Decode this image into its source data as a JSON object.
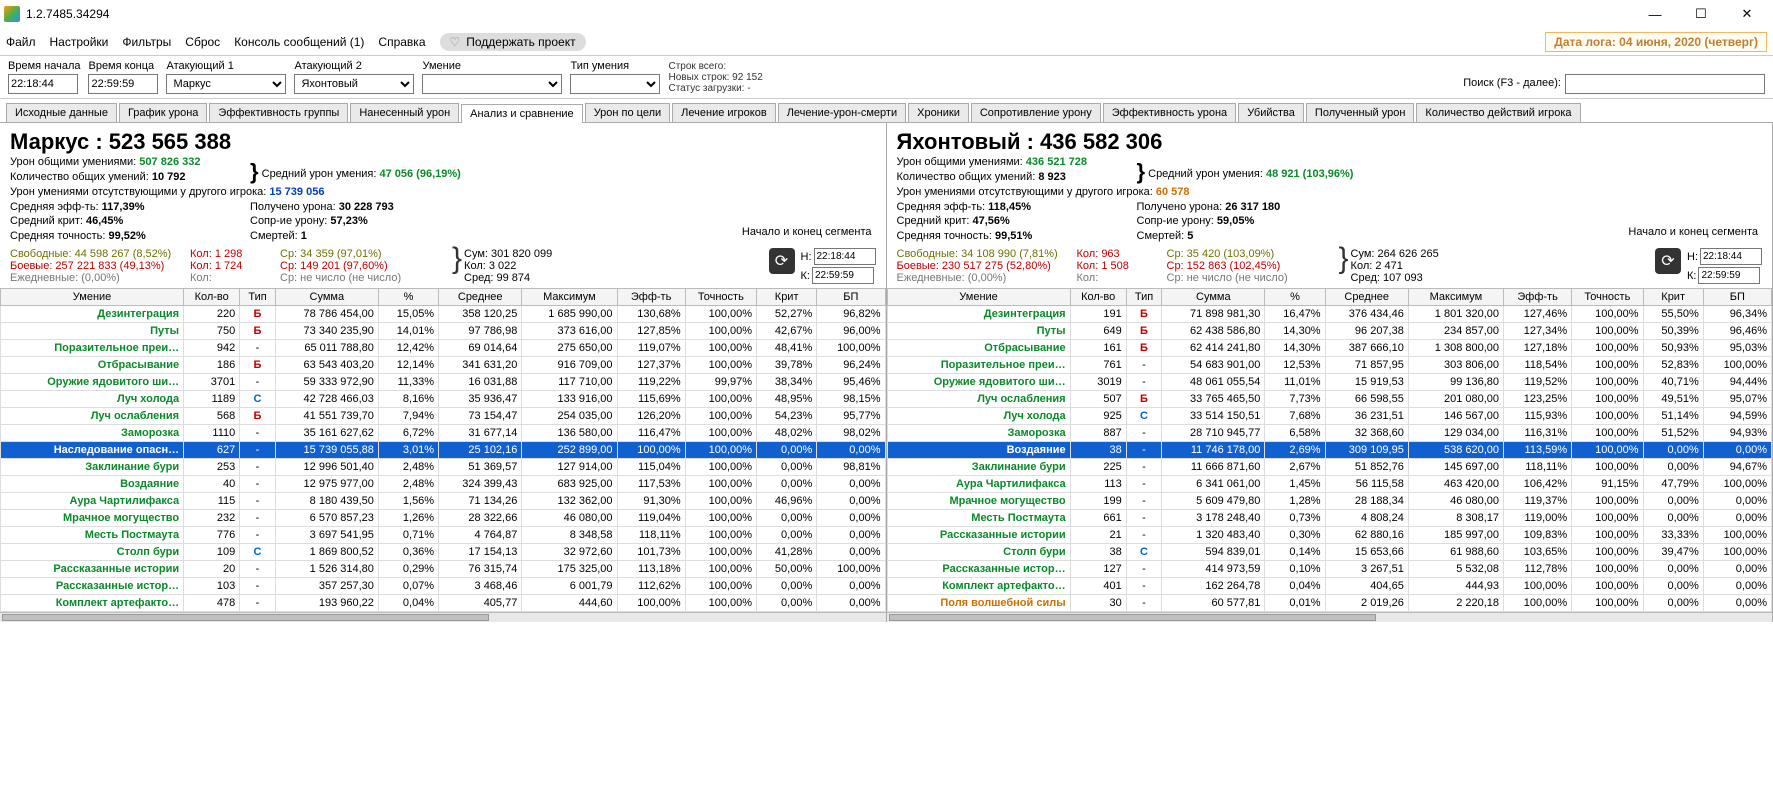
{
  "window": {
    "title": "1.2.7485.34294"
  },
  "menu": {
    "items": [
      "Файл",
      "Настройки",
      "Фильтры",
      "Сброс",
      "Консоль сообщений (1)",
      "Справка"
    ],
    "support": "Поддержать проект",
    "date": "Дата лога: 04 июня, 2020  (четверг)"
  },
  "filters": {
    "labels": {
      "start": "Время начала",
      "end": "Время конца",
      "att1": "Атакующий 1",
      "att2": "Атакующий 2",
      "skill": "Умение",
      "stype": "Тип умения",
      "search": "Поиск (F3 - далее):"
    },
    "values": {
      "start": "22:18:44",
      "end": "22:59:59",
      "att1": "Маркус",
      "att2": "Яхонтовый"
    },
    "stats": {
      "l1": "Строк всего:",
      "l2": "Новых строк: 92 152",
      "l3": "Статус загрузки: -"
    }
  },
  "tabs": [
    "Исходные данные",
    "График урона",
    "Эффективность группы",
    "Нанесенный урон",
    "Анализ и сравнение",
    "Урон по цели",
    "Лечение игроков",
    "Лечение-урон-смерти",
    "Хроники",
    "Сопротивление урону",
    "Эффективность урона",
    "Убийства",
    "Полученный урон",
    "Количество действий игрока"
  ],
  "tabs_active_index": 4,
  "seg_label": "Начало и конец\nсегмента",
  "left": {
    "title_name": "Маркус : ",
    "title_value": "523 565 388",
    "stats": [
      [
        "Урон общими умениями: ",
        "507 826 332",
        "green",
        "Средний урон умения: ",
        "47 056 (96,19%)",
        "green",
        "}"
      ],
      [
        "Количество общих умений: ",
        "10 792",
        "",
        "",
        "",
        "",
        " "
      ],
      [
        "Урон умениями отсутствующими у другого игрока: ",
        "15 739 056",
        "blue"
      ],
      [
        "Средняя эфф-ть: ",
        "117,39%",
        "",
        "Получено урона: ",
        "30 228 793",
        ""
      ],
      [
        "Средний крит: ",
        "46,45%",
        "",
        "Сопр-ие урону: ",
        "57,23%",
        ""
      ],
      [
        "Средняя точность: ",
        "99,52%",
        "",
        "Смертей: ",
        "1",
        ""
      ]
    ],
    "footer": {
      "free": "Свободные: 44 598 267 (8,52%)",
      "combat": "Боевые: 257 221 833 (49,13%)",
      "daily": "Ежедневные: (0,00%)",
      "kol1": "Кол: 1 298",
      "kol2": "Кол: 1 724",
      "kol3": "Кол:",
      "sr1": "Ср: 34 359 (97,01%)",
      "sr2": "Ср: 149 201 (97,60%)",
      "sr3": "Ср: не число (не число)",
      "sum": "Сум: 301 820 099",
      "kol": "Кол: 3 022",
      "sred": "Сред: 99 874",
      "tH": "22:18:44",
      "tK": "22:59:59"
    },
    "cols": [
      "Умение",
      "Кол-во",
      "Тип",
      "Сумма",
      "%",
      "Среднее",
      "Максимум",
      "Эфф-ть",
      "Точность",
      "Крит",
      "БП"
    ],
    "rows": [
      {
        "c": "r-green",
        "n": "Дезинтеграция",
        "k": "220",
        "t": "Б",
        "s": "78 786 454,00",
        "p": "15,05%",
        "sr": "358 120,25",
        "m": "1 685 990,00",
        "e": "130,68%",
        "a": "100,00%",
        "kr": "52,27%",
        "b": "96,82%"
      },
      {
        "c": "r-green",
        "n": "Путы",
        "k": "750",
        "t": "Б",
        "s": "73 340 235,90",
        "p": "14,01%",
        "sr": "97 786,98",
        "m": "373 616,00",
        "e": "127,85%",
        "a": "100,00%",
        "kr": "42,67%",
        "b": "96,00%"
      },
      {
        "c": "r-green",
        "n": "Поразительное преи…",
        "k": "942",
        "t": "-",
        "s": "65 011 788,80",
        "p": "12,42%",
        "sr": "69 014,64",
        "m": "275 650,00",
        "e": "119,07%",
        "a": "100,00%",
        "kr": "48,41%",
        "b": "100,00%"
      },
      {
        "c": "r-green",
        "n": "Отбрасывание",
        "k": "186",
        "t": "Б",
        "s": "63 543 403,20",
        "p": "12,14%",
        "sr": "341 631,20",
        "m": "916 709,00",
        "e": "127,37%",
        "a": "100,00%",
        "kr": "39,78%",
        "b": "96,24%"
      },
      {
        "c": "r-green",
        "n": "Оружие ядовитого ши…",
        "k": "3701",
        "t": "-",
        "s": "59 333 972,90",
        "p": "11,33%",
        "sr": "16 031,88",
        "m": "117 710,00",
        "e": "119,22%",
        "a": "99,97%",
        "kr": "38,34%",
        "b": "95,46%"
      },
      {
        "c": "r-green",
        "n": "Луч холода",
        "k": "1189",
        "t": "С",
        "s": "42 728 466,03",
        "p": "8,16%",
        "sr": "35 936,47",
        "m": "133 916,00",
        "e": "115,69%",
        "a": "100,00%",
        "kr": "48,95%",
        "b": "98,15%"
      },
      {
        "c": "r-green",
        "n": "Луч ослабления",
        "k": "568",
        "t": "Б",
        "s": "41 551 739,70",
        "p": "7,94%",
        "sr": "73 154,47",
        "m": "254 035,00",
        "e": "126,20%",
        "a": "100,00%",
        "kr": "54,23%",
        "b": "95,77%"
      },
      {
        "c": "r-green",
        "n": "Заморозка",
        "k": "1110",
        "t": "-",
        "s": "35 161 627,62",
        "p": "6,72%",
        "sr": "31 677,14",
        "m": "136 580,00",
        "e": "116,47%",
        "a": "100,00%",
        "kr": "48,02%",
        "b": "98,02%"
      },
      {
        "c": "selected",
        "n": "Наследование опасн…",
        "k": "627",
        "t": "-",
        "s": "15 739 055,88",
        "p": "3,01%",
        "sr": "25 102,16",
        "m": "252 899,00",
        "e": "100,00%",
        "a": "100,00%",
        "kr": "0,00%",
        "b": "0,00%"
      },
      {
        "c": "r-green",
        "n": "Заклинание бури",
        "k": "253",
        "t": "-",
        "s": "12 996 501,40",
        "p": "2,48%",
        "sr": "51 369,57",
        "m": "127 914,00",
        "e": "115,04%",
        "a": "100,00%",
        "kr": "0,00%",
        "b": "98,81%"
      },
      {
        "c": "r-green",
        "n": "Воздаяние",
        "k": "40",
        "t": "-",
        "s": "12 975 977,00",
        "p": "2,48%",
        "sr": "324 399,43",
        "m": "683 925,00",
        "e": "117,53%",
        "a": "100,00%",
        "kr": "0,00%",
        "b": "0,00%"
      },
      {
        "c": "r-green",
        "n": "Аура Чартилифакса",
        "k": "115",
        "t": "-",
        "s": "8 180 439,50",
        "p": "1,56%",
        "sr": "71 134,26",
        "m": "132 362,00",
        "e": "91,30%",
        "a": "100,00%",
        "kr": "46,96%",
        "b": "0,00%"
      },
      {
        "c": "r-green",
        "n": "Мрачное могущество",
        "k": "232",
        "t": "-",
        "s": "6 570 857,23",
        "p": "1,26%",
        "sr": "28 322,66",
        "m": "46 080,00",
        "e": "119,04%",
        "a": "100,00%",
        "kr": "0,00%",
        "b": "0,00%"
      },
      {
        "c": "r-green",
        "n": "Месть Постмаута",
        "k": "776",
        "t": "-",
        "s": "3 697 541,95",
        "p": "0,71%",
        "sr": "4 764,87",
        "m": "8 348,58",
        "e": "118,11%",
        "a": "100,00%",
        "kr": "0,00%",
        "b": "0,00%"
      },
      {
        "c": "r-green",
        "n": "Столп бури",
        "k": "109",
        "t": "С",
        "s": "1 869 800,52",
        "p": "0,36%",
        "sr": "17 154,13",
        "m": "32 972,60",
        "e": "101,73%",
        "a": "100,00%",
        "kr": "41,28%",
        "b": "0,00%"
      },
      {
        "c": "r-green",
        "n": "Рассказанные истории",
        "k": "20",
        "t": "-",
        "s": "1 526 314,80",
        "p": "0,29%",
        "sr": "76 315,74",
        "m": "175 325,00",
        "e": "113,18%",
        "a": "100,00%",
        "kr": "50,00%",
        "b": "100,00%"
      },
      {
        "c": "r-green",
        "n": "Рассказанные истор…",
        "k": "103",
        "t": "-",
        "s": "357 257,30",
        "p": "0,07%",
        "sr": "3 468,46",
        "m": "6 001,79",
        "e": "112,62%",
        "a": "100,00%",
        "kr": "0,00%",
        "b": "0,00%"
      },
      {
        "c": "r-green",
        "n": "Комплект артефакто…",
        "k": "478",
        "t": "-",
        "s": "193 960,22",
        "p": "0,04%",
        "sr": "405,77",
        "m": "444,60",
        "e": "100,00%",
        "a": "100,00%",
        "kr": "0,00%",
        "b": "0,00%"
      }
    ]
  },
  "right": {
    "title_name": "Яхонтовый : ",
    "title_value": "436 582 306",
    "stats": [
      [
        "Урон общими умениями: ",
        "436 521 728",
        "green",
        "Средний урон умения: ",
        "48 921 (103,96%)",
        "green",
        "}"
      ],
      [
        "Количество общих умений: ",
        "8 923",
        "",
        "",
        "",
        "",
        " "
      ],
      [
        "Урон умениями отсутствующими у другого игрока: ",
        "60 578",
        "orange"
      ],
      [
        "Средняя эфф-ть: ",
        "118,45%",
        "",
        "Получено урона: ",
        "26 317 180",
        ""
      ],
      [
        "Средний крит: ",
        "47,56%",
        "",
        "Сопр-ие урону: ",
        "59,05%",
        ""
      ],
      [
        "Средняя точность: ",
        "99,51%",
        "",
        "Смертей: ",
        "5",
        ""
      ]
    ],
    "footer": {
      "free": "Свободные: 34 108 990 (7,81%)",
      "combat": "Боевые: 230 517 275 (52,80%)",
      "daily": "Ежедневные: (0,00%)",
      "kol1": "Кол: 963",
      "kol2": "Кол: 1 508",
      "kol3": "Кол:",
      "sr1": "Ср: 35 420 (103,09%)",
      "sr2": "Ср: 152 863 (102,45%)",
      "sr3": "Ср: не число (не число)",
      "sum": "Сум: 264 626 265",
      "kol": "Кол: 2 471",
      "sred": "Сред: 107 093",
      "tH": "22:18:44",
      "tK": "22:59:59"
    },
    "cols": [
      "Умение",
      "Кол-во",
      "Тип",
      "Сумма",
      "%",
      "Среднее",
      "Максимум",
      "Эфф-ть",
      "Точность",
      "Крит",
      "БП"
    ],
    "rows": [
      {
        "c": "r-green",
        "n": "Дезинтеграция",
        "k": "191",
        "t": "Б",
        "s": "71 898 981,30",
        "p": "16,47%",
        "sr": "376 434,46",
        "m": "1 801 320,00",
        "e": "127,46%",
        "a": "100,00%",
        "kr": "55,50%",
        "b": "96,34%"
      },
      {
        "c": "r-green",
        "n": "Путы",
        "k": "649",
        "t": "Б",
        "s": "62 438 586,80",
        "p": "14,30%",
        "sr": "96 207,38",
        "m": "234 857,00",
        "e": "127,34%",
        "a": "100,00%",
        "kr": "50,39%",
        "b": "96,46%"
      },
      {
        "c": "r-green",
        "n": "Отбрасывание",
        "k": "161",
        "t": "Б",
        "s": "62 414 241,80",
        "p": "14,30%",
        "sr": "387 666,10",
        "m": "1 308 800,00",
        "e": "127,18%",
        "a": "100,00%",
        "kr": "50,93%",
        "b": "95,03%"
      },
      {
        "c": "r-green",
        "n": "Поразительное преи…",
        "k": "761",
        "t": "-",
        "s": "54 683 901,00",
        "p": "12,53%",
        "sr": "71 857,95",
        "m": "303 806,00",
        "e": "118,54%",
        "a": "100,00%",
        "kr": "52,83%",
        "b": "100,00%"
      },
      {
        "c": "r-green",
        "n": "Оружие ядовитого ши…",
        "k": "3019",
        "t": "-",
        "s": "48 061 055,54",
        "p": "11,01%",
        "sr": "15 919,53",
        "m": "99 136,80",
        "e": "119,52%",
        "a": "100,00%",
        "kr": "40,71%",
        "b": "94,44%"
      },
      {
        "c": "r-green",
        "n": "Луч ослабления",
        "k": "507",
        "t": "Б",
        "s": "33 765 465,50",
        "p": "7,73%",
        "sr": "66 598,55",
        "m": "201 080,00",
        "e": "123,25%",
        "a": "100,00%",
        "kr": "49,51%",
        "b": "95,07%"
      },
      {
        "c": "r-green",
        "n": "Луч холода",
        "k": "925",
        "t": "С",
        "s": "33 514 150,51",
        "p": "7,68%",
        "sr": "36 231,51",
        "m": "146 567,00",
        "e": "115,93%",
        "a": "100,00%",
        "kr": "51,14%",
        "b": "94,59%"
      },
      {
        "c": "r-green",
        "n": "Заморозка",
        "k": "887",
        "t": "-",
        "s": "28 710 945,77",
        "p": "6,58%",
        "sr": "32 368,60",
        "m": "129 034,00",
        "e": "116,31%",
        "a": "100,00%",
        "kr": "51,52%",
        "b": "94,93%"
      },
      {
        "c": "selected",
        "n": "Воздаяние",
        "k": "38",
        "t": "-",
        "s": "11 746 178,00",
        "p": "2,69%",
        "sr": "309 109,95",
        "m": "538 620,00",
        "e": "113,59%",
        "a": "100,00%",
        "kr": "0,00%",
        "b": "0,00%"
      },
      {
        "c": "r-green",
        "n": "Заклинание бури",
        "k": "225",
        "t": "-",
        "s": "11 666 871,60",
        "p": "2,67%",
        "sr": "51 852,76",
        "m": "145 697,00",
        "e": "118,11%",
        "a": "100,00%",
        "kr": "0,00%",
        "b": "94,67%"
      },
      {
        "c": "r-green",
        "n": "Аура Чартилифакса",
        "k": "113",
        "t": "-",
        "s": "6 341 061,00",
        "p": "1,45%",
        "sr": "56 115,58",
        "m": "463 420,00",
        "e": "106,42%",
        "a": "91,15%",
        "kr": "47,79%",
        "b": "100,00%"
      },
      {
        "c": "r-green",
        "n": "Мрачное могущество",
        "k": "199",
        "t": "-",
        "s": "5 609 479,80",
        "p": "1,28%",
        "sr": "28 188,34",
        "m": "46 080,00",
        "e": "119,37%",
        "a": "100,00%",
        "kr": "0,00%",
        "b": "0,00%"
      },
      {
        "c": "r-green",
        "n": "Месть Постмаута",
        "k": "661",
        "t": "-",
        "s": "3 178 248,40",
        "p": "0,73%",
        "sr": "4 808,24",
        "m": "8 308,17",
        "e": "119,00%",
        "a": "100,00%",
        "kr": "0,00%",
        "b": "0,00%"
      },
      {
        "c": "r-green",
        "n": "Рассказанные истории",
        "k": "21",
        "t": "-",
        "s": "1 320 483,40",
        "p": "0,30%",
        "sr": "62 880,16",
        "m": "185 997,00",
        "e": "109,83%",
        "a": "100,00%",
        "kr": "33,33%",
        "b": "100,00%"
      },
      {
        "c": "r-green",
        "n": "Столп бури",
        "k": "38",
        "t": "С",
        "s": "594 839,01",
        "p": "0,14%",
        "sr": "15 653,66",
        "m": "61 988,60",
        "e": "103,65%",
        "a": "100,00%",
        "kr": "39,47%",
        "b": "100,00%"
      },
      {
        "c": "r-green",
        "n": "Рассказанные истор…",
        "k": "127",
        "t": "-",
        "s": "414 973,59",
        "p": "0,10%",
        "sr": "3 267,51",
        "m": "5 532,08",
        "e": "112,78%",
        "a": "100,00%",
        "kr": "0,00%",
        "b": "0,00%"
      },
      {
        "c": "r-green",
        "n": "Комплект артефакто…",
        "k": "401",
        "t": "-",
        "s": "162 264,78",
        "p": "0,04%",
        "sr": "404,65",
        "m": "444,93",
        "e": "100,00%",
        "a": "100,00%",
        "kr": "0,00%",
        "b": "0,00%"
      },
      {
        "c": "r-orange",
        "n": "Поля волшебной силы",
        "k": "30",
        "t": "-",
        "s": "60 577,81",
        "p": "0,01%",
        "sr": "2 019,26",
        "m": "2 220,18",
        "e": "100,00%",
        "a": "100,00%",
        "kr": "0,00%",
        "b": "0,00%"
      }
    ]
  }
}
